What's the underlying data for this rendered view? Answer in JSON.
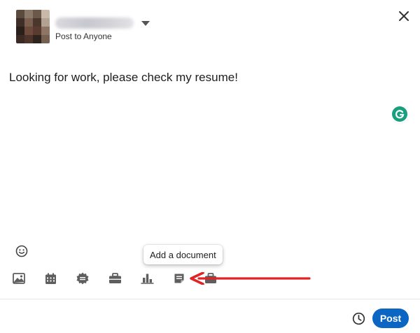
{
  "header": {
    "visibility_label": "Post to Anyone",
    "author_name_blurred": true
  },
  "editor": {
    "text": "Looking for work, please check my resume!"
  },
  "tooltip": {
    "label": "Add a document"
  },
  "toolbar": {
    "items": [
      {
        "icon": "image-icon"
      },
      {
        "icon": "calendar-event-icon"
      },
      {
        "icon": "celebrate-icon"
      },
      {
        "icon": "briefcase-icon"
      },
      {
        "icon": "poll-icon"
      },
      {
        "icon": "document-icon"
      },
      {
        "icon": "more-icon"
      }
    ]
  },
  "footer": {
    "post_label": "Post"
  },
  "colors": {
    "primary": "#0a66c2",
    "icon": "#5e5e5e",
    "annotation_arrow": "#e02424",
    "grammarly": "#17a07e"
  }
}
